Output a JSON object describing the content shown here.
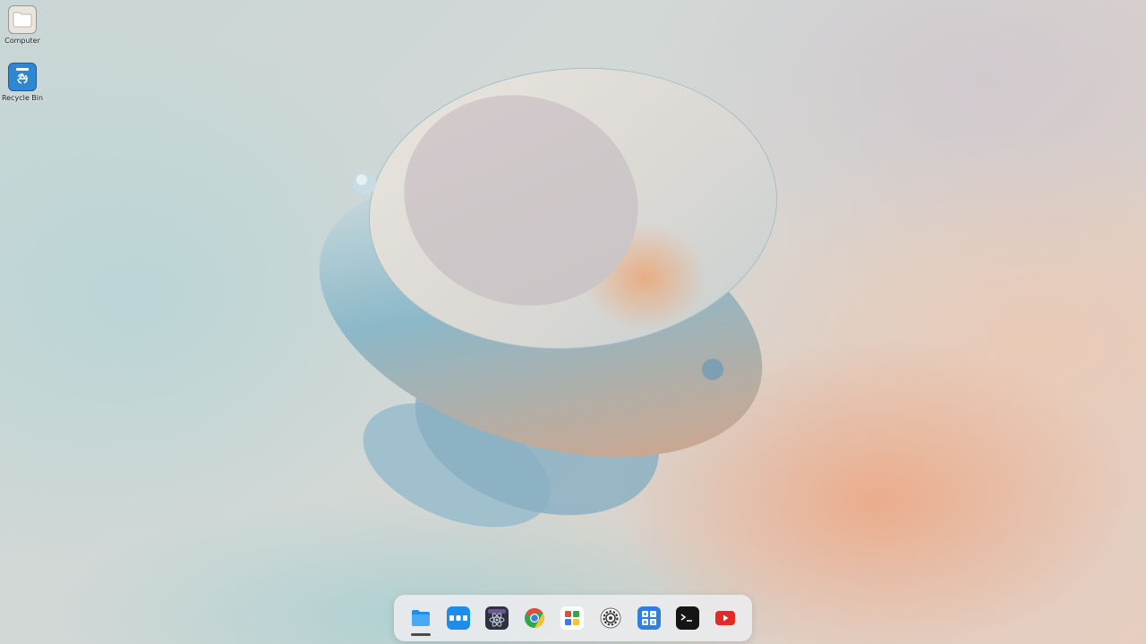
{
  "desktop": {
    "icons": [
      {
        "label": "Computer",
        "icon": "folder-icon"
      },
      {
        "label": "Recycle Bin",
        "icon": "recycle-bin-icon"
      }
    ]
  },
  "dock": {
    "items": [
      {
        "name": "File Manager",
        "icon": "folder-icon",
        "active": true
      },
      {
        "name": "App Launcher",
        "icon": "launcher-dots-icon",
        "active": false
      },
      {
        "name": "Atom Editor",
        "icon": "atom-icon",
        "active": false
      },
      {
        "name": "Chrome",
        "icon": "chrome-icon",
        "active": false
      },
      {
        "name": "App Store",
        "icon": "store-grid-icon",
        "active": false
      },
      {
        "name": "Settings",
        "icon": "gear-icon",
        "active": false
      },
      {
        "name": "Calculator",
        "icon": "calculator-icon",
        "active": false
      },
      {
        "name": "Terminal",
        "icon": "terminal-icon",
        "active": false
      },
      {
        "name": "YouTube",
        "icon": "youtube-icon",
        "active": false
      }
    ]
  },
  "colors": {
    "chrome_red": "#e24c3f",
    "chrome_yellow": "#f7c233",
    "chrome_green": "#2fa64f",
    "chrome_blue": "#3b7de0",
    "youtube_red": "#e22b26",
    "files_blue": "#1e8de8"
  }
}
